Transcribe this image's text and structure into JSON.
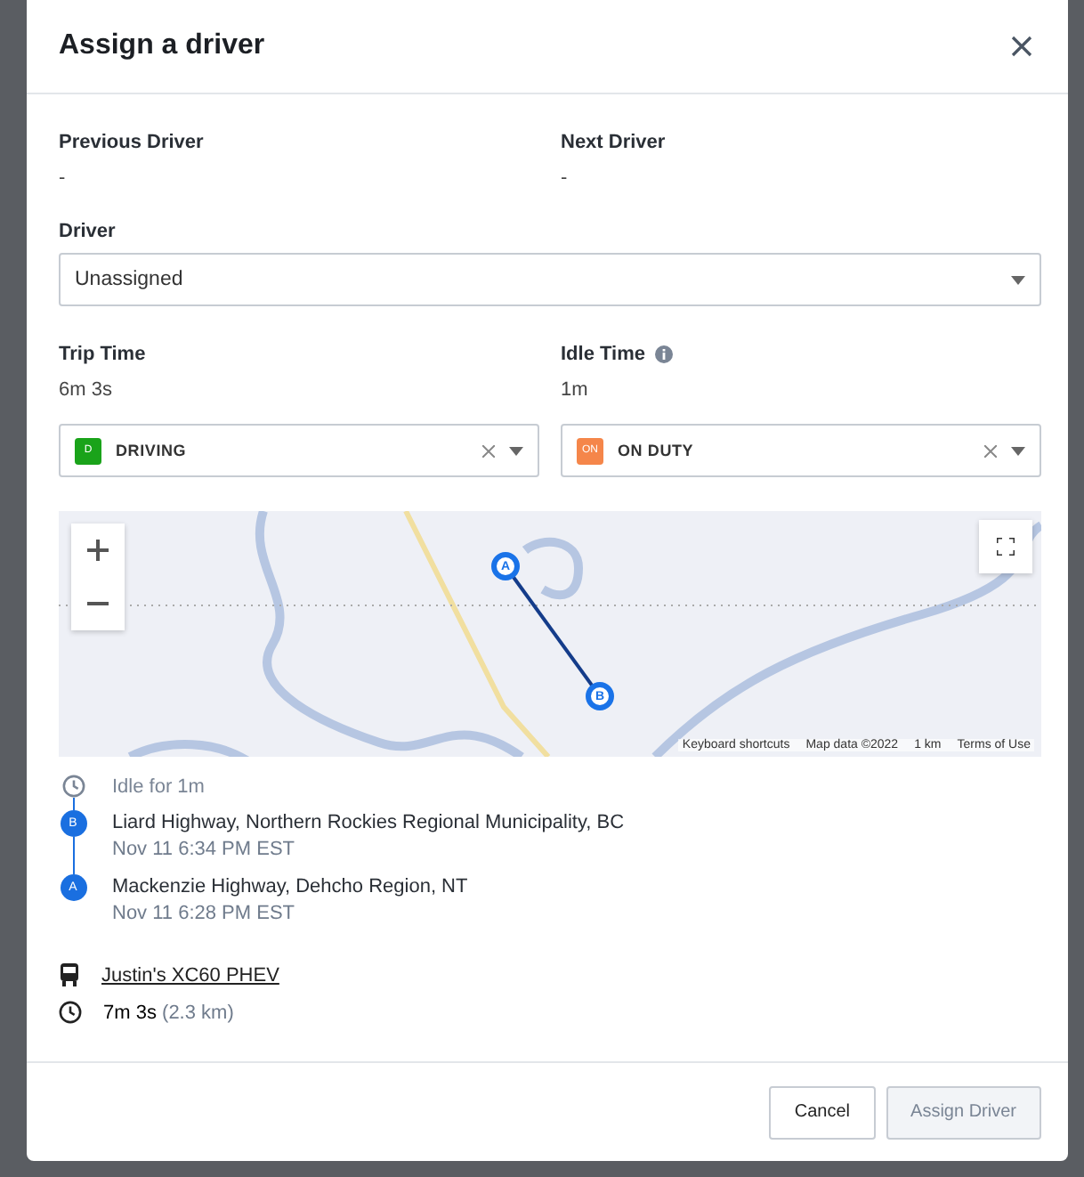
{
  "dialog": {
    "title": "Assign a driver"
  },
  "drivers": [
    {
      "label": "Previous Driver",
      "value": "-"
    },
    {
      "label": "Next Driver",
      "value": "-"
    }
  ],
  "driver_select": {
    "label": "Driver",
    "value": "Unassigned"
  },
  "times": [
    {
      "label": "Trip Time",
      "value": "6m 3s",
      "info": false
    },
    {
      "label": "Idle Time",
      "value": "1m",
      "info": true
    }
  ],
  "statuses": [
    {
      "badge": "D",
      "label": "DRIVING",
      "color": "#1aa31a"
    },
    {
      "badge": "ON",
      "label": "ON DUTY",
      "color": "#f5864a"
    }
  ],
  "map": {
    "markers": [
      "A",
      "B"
    ],
    "attribution": [
      "Keyboard shortcuts",
      "Map data ©2022",
      "1 km",
      "Terms of Use"
    ]
  },
  "timeline": [
    {
      "kind": "idle",
      "title": "Idle for 1m"
    },
    {
      "kind": "stop",
      "marker": "B",
      "title": "Liard Highway, Northern Rockies Regional Municipality, BC",
      "time": "Nov 11 6:34 PM EST"
    },
    {
      "kind": "stop",
      "marker": "A",
      "title": "Mackenzie Highway, Dehcho Region, NT",
      "time": "Nov 11 6:28 PM EST"
    }
  ],
  "vehicle": {
    "name": "Justin's XC60 PHEV"
  },
  "duration": {
    "time": "7m 3s",
    "distance": "(2.3 km)"
  },
  "buttons": [
    {
      "label": "Cancel",
      "disabled": false
    },
    {
      "label": "Assign Driver",
      "disabled": true
    }
  ]
}
